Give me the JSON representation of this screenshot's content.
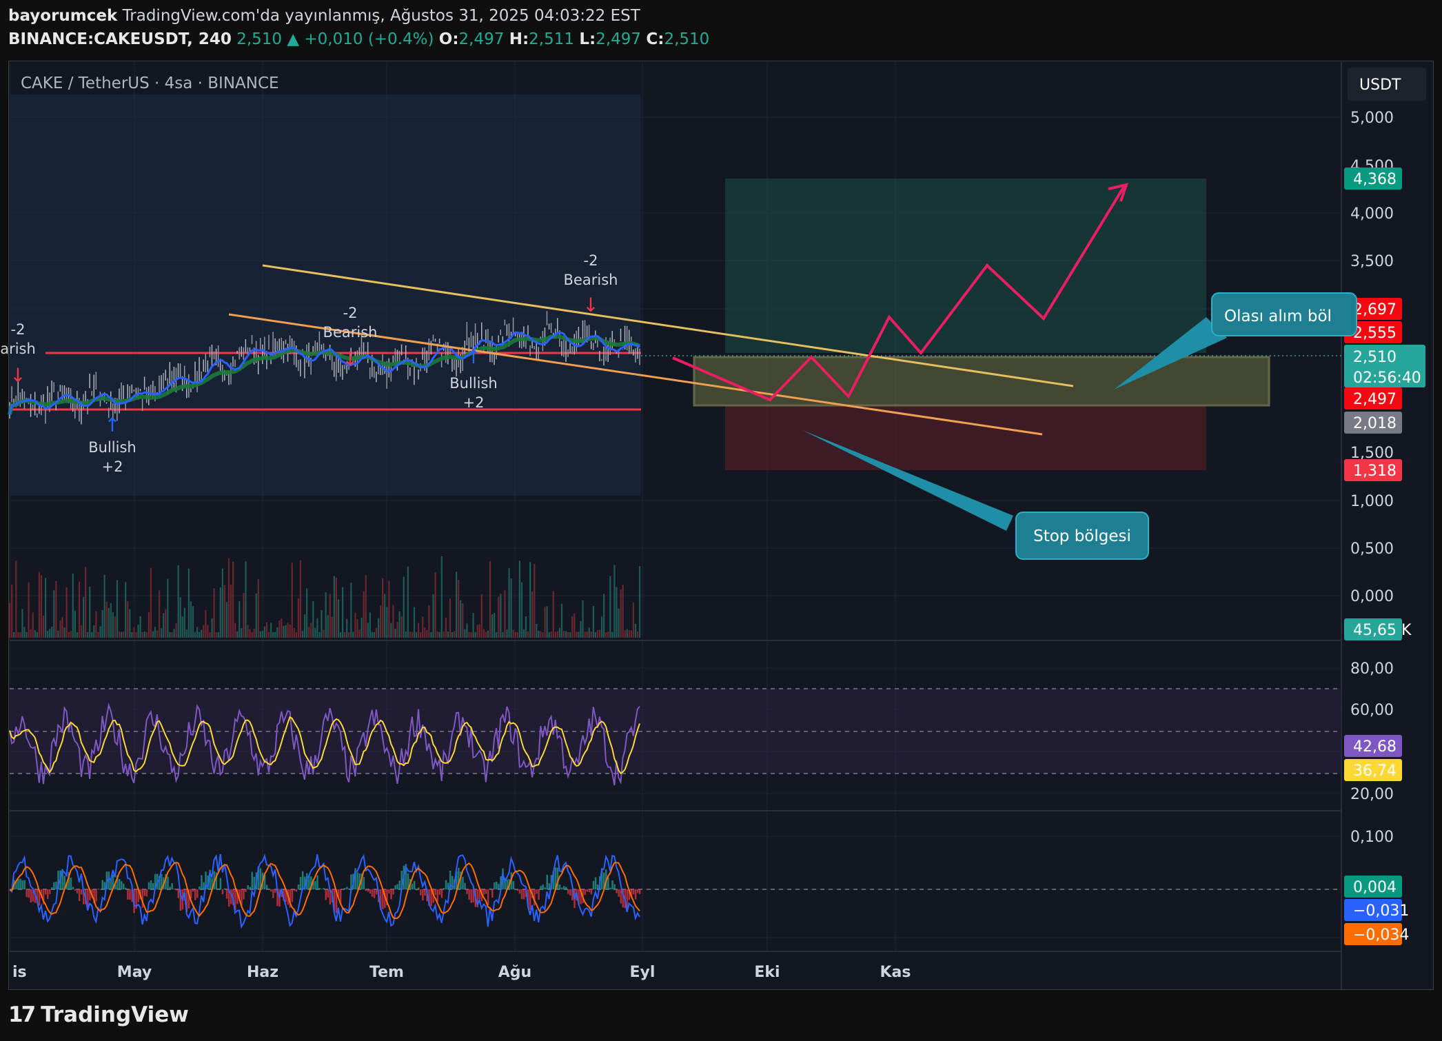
{
  "header": {
    "author": "bayorumcek",
    "published": "TradingView.com'da yayınlanmış, Ağustos 31, 2025 04:03:22 EST",
    "symbol": "BINANCE:CAKEUSDT, 240",
    "last": "2,510",
    "change": "+0,010 (+0.4%)",
    "o_label": "O:",
    "o": "2,497",
    "h_label": "H:",
    "h": "2,511",
    "l_label": "L:",
    "l": "2,497",
    "c_label": "C:",
    "c": "2,510"
  },
  "legend": "CAKE / TetherUS · 4sa · BINANCE",
  "currency": "USDT",
  "logo": "TradingView",
  "colors": {
    "up": "#22ab94",
    "down": "#f23645",
    "rsi": "#7e57c2",
    "rsi_ma": "#fdd835",
    "macd": "#2962ff",
    "signal": "#ff6d00"
  },
  "chart_data": [
    {
      "type": "line",
      "title": "CAKE / TetherUS · 4sa · BINANCE",
      "x_ticks": [
        "is",
        "May",
        "Haz",
        "Tem",
        "Ağu",
        "Eyl",
        "Eki",
        "Kas"
      ],
      "y_ticks": [
        "5,000",
        "4,500",
        "4,000",
        "3,500",
        "1,500",
        "1,000",
        "0,500",
        "0,000"
      ],
      "ylim": [
        0,
        5.2
      ],
      "series": [
        {
          "x": [
            "Nis",
            "May",
            "Haz",
            "Tem",
            "Ağu",
            "Eyl"
          ],
          "values": [
            1.95,
            2.05,
            2.55,
            2.35,
            2.7,
            2.51
          ]
        }
      ],
      "price_labels": [
        {
          "text": "4,368",
          "color": "#089981"
        },
        {
          "text": "2,697",
          "color": "#f7070f"
        },
        {
          "text": "2,555",
          "color": "#f7070f"
        },
        {
          "text": "2,510",
          "sub": "02:56:40",
          "color": "#26a69a"
        },
        {
          "text": "2,497",
          "color": "#f7070f"
        },
        {
          "text": "2,018",
          "color": "#787b86"
        },
        {
          "text": "1,318",
          "color": "#f23645"
        },
        {
          "text": "45,65 K",
          "color": "#26a69a"
        }
      ],
      "signals": [
        {
          "text": "-2",
          "sub": "Bearish",
          "x": "Haz"
        },
        {
          "text": "-2",
          "sub": "Bearish",
          "x": "Ağu"
        },
        {
          "text": "-2",
          "sub": "arish",
          "x": "is"
        },
        {
          "text": "Bullish",
          "sub": "+2",
          "x": "May"
        },
        {
          "text": "Bullish",
          "sub": "+2",
          "x": "Ağu"
        }
      ],
      "annotations": [
        "Olası alım böl",
        "Stop bölgesi"
      ],
      "grid": true
    },
    {
      "type": "line",
      "y_ticks": [
        "80,00",
        "60,00",
        "20,00"
      ],
      "price_labels": [
        {
          "text": "42,68",
          "color": "#7e57c2"
        },
        {
          "text": "36,74",
          "color": "#fdd835"
        }
      ]
    },
    {
      "type": "bar",
      "y_ticks": [
        "0,100"
      ],
      "price_labels": [
        {
          "text": "0,004",
          "color": "#089981"
        },
        {
          "text": "−0,031",
          "color": "#2962ff"
        },
        {
          "text": "−0,034",
          "color": "#ff6d00"
        }
      ]
    }
  ]
}
